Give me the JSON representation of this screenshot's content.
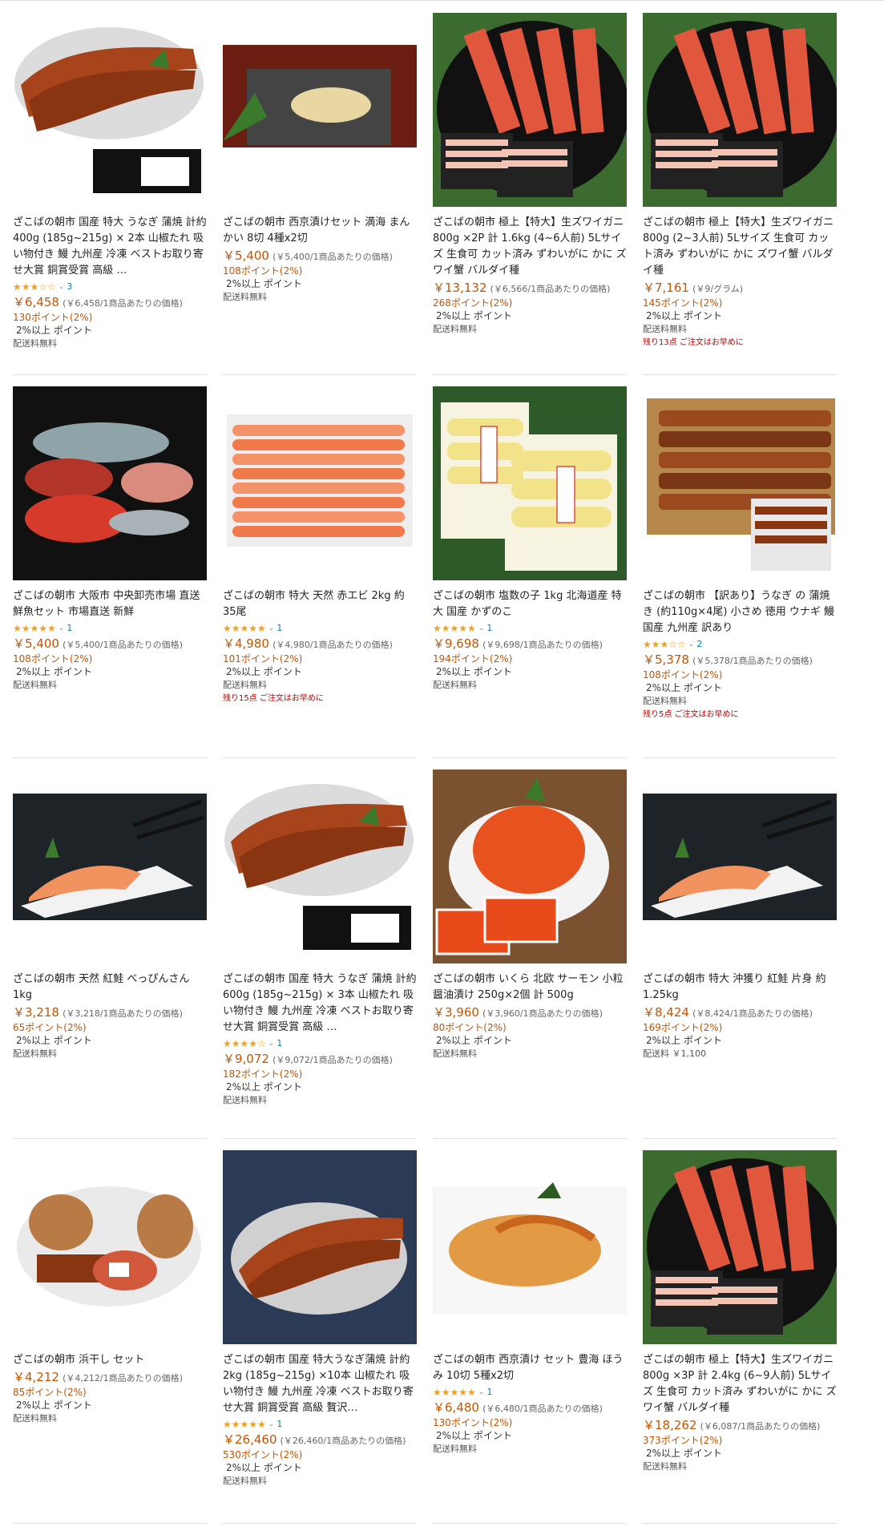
{
  "products": [
    {
      "title": "ざこばの朝市 国産 特大 うなぎ 蒲焼 計約 400g (185g~215g) × 2本 山椒たれ 吸い物付き 鰻 九州産 冷凍 ベストお取り寄せ大賞 銅賞受賞 高級 …",
      "rating": "★★★☆☆",
      "reviews": "3",
      "price": "￥6,458",
      "unit": "(￥6,458/1商品あたりの価格)",
      "points": "130ポイント(2%)",
      "pct": "2%以上 ポイント",
      "shipping": "配送料無料",
      "stock": "",
      "img": "eel-box"
    },
    {
      "title": "ざこばの朝市 西京漬けセット 満海 まんかい 8切 4種x2切",
      "rating": "",
      "reviews": "",
      "price": "￥5,400",
      "unit": "(￥5,400/1商品あたりの価格)",
      "points": "108ポイント(2%)",
      "pct": "2%以上 ポイント",
      "shipping": "配送料無料",
      "stock": "",
      "img": "saikyo"
    },
    {
      "title": "ざこばの朝市 極上【特大】生ズワイガニ 800g ×2P 計 1.6kg (4~6人前) 5Lサイズ 生食可 カット済み ずわいがに かに ズワイ蟹 バルダイ種",
      "rating": "",
      "reviews": "",
      "price": "￥13,132",
      "unit": "(￥6,566/1商品あたりの価格)",
      "points": "268ポイント(2%)",
      "pct": "2%以上 ポイント",
      "shipping": "配送料無料",
      "stock": "",
      "img": "crab"
    },
    {
      "title": "ざこばの朝市 極上【特大】生ズワイガニ 800g (2~3人前) 5Lサイズ 生食可 カット済み ずわいがに かに ズワイ蟹 バルダイ種",
      "rating": "",
      "reviews": "",
      "price": "￥7,161",
      "unit": "(￥9/グラム)",
      "points": "145ポイント(2%)",
      "pct": "2%以上 ポイント",
      "shipping": "配送料無料",
      "stock": "残り13点 ご注文はお早めに",
      "img": "crab"
    },
    {
      "title": "ざこばの朝市 大阪市 中央卸売市場 直送 鮮魚セット 市場直送 新鮮",
      "rating": "★★★★★",
      "reviews": "1",
      "price": "￥5,400",
      "unit": "(￥5,400/1商品あたりの価格)",
      "points": "108ポイント(2%)",
      "pct": "2%以上 ポイント",
      "shipping": "配送料無料",
      "stock": "",
      "img": "fish"
    },
    {
      "title": "ざこばの朝市 特大 天然 赤エビ 2kg 約35尾",
      "rating": "★★★★★",
      "reviews": "1",
      "price": "￥4,980",
      "unit": "(￥4,980/1商品あたりの価格)",
      "points": "101ポイント(2%)",
      "pct": "2%以上 ポイント",
      "shipping": "配送料無料",
      "stock": "残り15点 ご注文はお早めに",
      "img": "shrimp"
    },
    {
      "title": "ざこばの朝市 塩数の子 1kg 北海道産 特大 国産 かずのこ",
      "rating": "★★★★★",
      "reviews": "1",
      "price": "￥9,698",
      "unit": "(￥9,698/1商品あたりの価格)",
      "points": "194ポイント(2%)",
      "pct": "2%以上 ポイント",
      "shipping": "配送料無料",
      "stock": "",
      "img": "roe"
    },
    {
      "title": "ざこばの朝市 【訳あり】うなぎ の 蒲焼き (約110g×4尾) 小さめ 徳用 ウナギ 鰻 国産 九州産 訳あり",
      "rating": "★★★☆☆",
      "reviews": "2",
      "price": "￥5,378",
      "unit": "(￥5,378/1商品あたりの価格)",
      "points": "108ポイント(2%)",
      "pct": "2%以上 ポイント",
      "shipping": "配送料無料",
      "stock": "残り5点 ご注文はお早めに",
      "img": "eel-bento"
    },
    {
      "title": "ざこばの朝市 天然 紅鮭 べっぴんさん 1kg",
      "rating": "",
      "reviews": "",
      "price": "￥3,218",
      "unit": "(￥3,218/1商品あたりの価格)",
      "points": "65ポイント(2%)",
      "pct": "2%以上 ポイント",
      "shipping": "配送料無料",
      "stock": "",
      "img": "salmon"
    },
    {
      "title": "ざこばの朝市 国産 特大 うなぎ 蒲焼 計約 600g (185g~215g) × 3本 山椒たれ 吸い物付き 鰻 九州産 冷凍 ベストお取り寄せ大賞 銅賞受賞 高級 …",
      "rating": "★★★★☆",
      "reviews": "1",
      "price": "￥9,072",
      "unit": "(￥9,072/1商品あたりの価格)",
      "points": "182ポイント(2%)",
      "pct": "2%以上 ポイント",
      "shipping": "配送料無料",
      "stock": "",
      "img": "eel-box"
    },
    {
      "title": "ざこばの朝市 いくら 北欧 サーモン 小粒 醤油漬け 250g×2個 計 500g",
      "rating": "",
      "reviews": "",
      "price": "￥3,960",
      "unit": "(￥3,960/1商品あたりの価格)",
      "points": "80ポイント(2%)",
      "pct": "2%以上 ポイント",
      "shipping": "配送料無料",
      "stock": "",
      "img": "ikura"
    },
    {
      "title": "ざこばの朝市 特大 沖獲り 紅鮭 片身 約1.25kg",
      "rating": "",
      "reviews": "",
      "price": "￥8,424",
      "unit": "(￥8,424/1商品あたりの価格)",
      "points": "169ポイント(2%)",
      "pct": "2%以上 ポイント",
      "shipping": "配送料 ￥1,100",
      "stock": "",
      "img": "salmon"
    },
    {
      "title": "ざこばの朝市 浜干し セット",
      "rating": "",
      "reviews": "",
      "price": "￥4,212",
      "unit": "(￥4,212/1商品あたりの価格)",
      "points": "85ポイント(2%)",
      "pct": "2%以上 ポイント",
      "shipping": "配送料無料",
      "stock": "",
      "img": "himono"
    },
    {
      "title": "ざこばの朝市 国産 特大うなぎ蒲焼 計約 2kg (185g~215g) ×10本 山椒たれ 吸い物付き 鰻 九州産 冷凍 ベストお取り寄せ大賞 銅賞受賞 高級 贅沢…",
      "rating": "★★★★★",
      "reviews": "1",
      "price": "￥26,460",
      "unit": "(￥26,460/1商品あたりの価格)",
      "points": "530ポイント(2%)",
      "pct": "2%以上 ポイント",
      "shipping": "配送料無料",
      "stock": "",
      "img": "eel-dark"
    },
    {
      "title": "ざこばの朝市 西京漬け セット 豊海 ほうみ 10切 5種x2切",
      "rating": "★★★★★",
      "reviews": "1",
      "price": "￥6,480",
      "unit": "(￥6,480/1商品あたりの価格)",
      "points": "130ポイント(2%)",
      "pct": "2%以上 ポイント",
      "shipping": "配送料無料",
      "stock": "",
      "img": "saikyo2"
    },
    {
      "title": "ざこばの朝市 極上【特大】生ズワイガニ 800g ×3P 計 2.4kg (6~9人前) 5Lサイズ 生食可 カット済み ずわいがに かに ズワイ蟹 バルダイ種",
      "rating": "",
      "reviews": "",
      "price": "￥18,262",
      "unit": "(￥6,087/1商品あたりの価格)",
      "points": "373ポイント(2%)",
      "pct": "2%以上 ポイント",
      "shipping": "配送料無料",
      "stock": "",
      "img": "crab"
    }
  ],
  "colors": {
    "price": "#c45500",
    "stock": "#c40000",
    "star": "#f0a020"
  }
}
